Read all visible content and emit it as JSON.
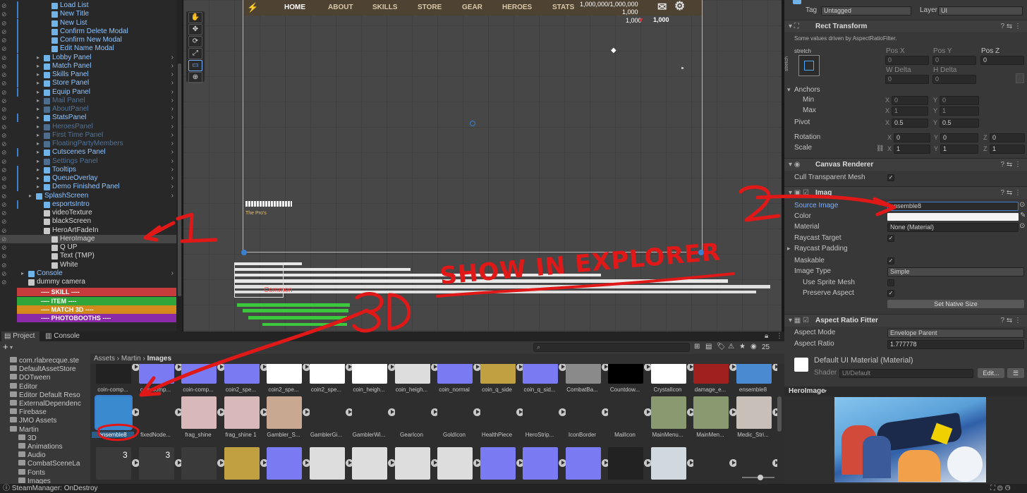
{
  "hierarchy": {
    "items": [
      {
        "label": "Load List",
        "indent": 5,
        "style": "blue"
      },
      {
        "label": "New Title",
        "indent": 5,
        "style": "blue"
      },
      {
        "label": "New List",
        "indent": 5,
        "style": "blue"
      },
      {
        "label": "Confirm Delete Modal",
        "indent": 5,
        "style": "blue"
      },
      {
        "label": "Confirm New Modal",
        "indent": 5,
        "style": "blue"
      },
      {
        "label": "Edit Name Modal",
        "indent": 5,
        "style": "blue"
      },
      {
        "label": "Lobby Panel",
        "indent": 4,
        "style": "blue",
        "arrow": true
      },
      {
        "label": "Match Panel",
        "indent": 4,
        "style": "blue",
        "arrow": true
      },
      {
        "label": "Skills Panel",
        "indent": 4,
        "style": "blue",
        "arrow": true
      },
      {
        "label": "Store Panel",
        "indent": 4,
        "style": "blue",
        "arrow": true
      },
      {
        "label": "Equip Panel",
        "indent": 4,
        "style": "blue",
        "arrow": true
      },
      {
        "label": "Mail Panel",
        "indent": 4,
        "style": "dim",
        "arrow": true
      },
      {
        "label": "AboutPanel",
        "indent": 4,
        "style": "dim",
        "arrow": true
      },
      {
        "label": "StatsPanel",
        "indent": 4,
        "style": "blue",
        "arrow": true
      },
      {
        "label": "HeroesPanel",
        "indent": 4,
        "style": "dim",
        "arrow": true
      },
      {
        "label": "First Time Panel",
        "indent": 4,
        "style": "dim",
        "arrow": true
      },
      {
        "label": "FloatingPartyMembers",
        "indent": 4,
        "style": "dim",
        "arrow": true
      },
      {
        "label": "Cutscenes Panel",
        "indent": 4,
        "style": "blue",
        "arrow": true
      },
      {
        "label": "Settings Panel",
        "indent": 4,
        "style": "dim",
        "arrow": true
      },
      {
        "label": "Tooltips",
        "indent": 4,
        "style": "blue",
        "arrow": true
      },
      {
        "label": "QueueOverlay",
        "indent": 4,
        "style": "blue",
        "arrow": true
      },
      {
        "label": "Demo Finished Panel",
        "indent": 4,
        "style": "blue",
        "arrow": true
      },
      {
        "label": "SplashScreen",
        "indent": 3,
        "style": "blue",
        "arrow": true
      },
      {
        "label": "esportsIntro",
        "indent": 4,
        "style": "blue"
      },
      {
        "label": "videoTexture",
        "indent": 4,
        "style": "wht"
      },
      {
        "label": "blackScreen",
        "indent": 4,
        "style": "wht"
      },
      {
        "label": "HeroArtFadeIn",
        "indent": 4,
        "style": "wht"
      },
      {
        "label": "HeroImage",
        "indent": 5,
        "style": "wht",
        "selected": true
      },
      {
        "label": "Q UP",
        "indent": 5,
        "style": "wht"
      },
      {
        "label": "Text (TMP)",
        "indent": 5,
        "style": "wht"
      },
      {
        "label": "White",
        "indent": 5,
        "style": "wht"
      },
      {
        "label": "Console",
        "indent": 2,
        "style": "blue",
        "arrow": true
      },
      {
        "label": "dummy camera",
        "indent": 2,
        "style": "wht"
      }
    ],
    "color_sections": [
      {
        "label": "---- SKILL ----",
        "color": "#c63b3b"
      },
      {
        "label": "---- ITEM ----",
        "color": "#2fa53a"
      },
      {
        "label": "---- MATCH 3D ----",
        "color": "#d4891c"
      },
      {
        "label": "---- PHOTOBOOTHS ----",
        "color": "#8a2aa8"
      }
    ]
  },
  "scene": {
    "nav": [
      "HOME",
      "ABOUT",
      "SKILLS",
      "STORE",
      "GEAR",
      "HEROES",
      "STATS"
    ],
    "currency_1": "1,000,000/1,000,000",
    "currency_2": "1,000",
    "currency_3": "1,000",
    "currency_4": "1,000",
    "pros_label": "The Pro's",
    "common_label": "Common",
    "tools": [
      "✋",
      "✥",
      "⟳",
      "⤢",
      "▭",
      "⊕"
    ]
  },
  "inspector": {
    "tag_label": "Tag",
    "tag_value": "Untagged",
    "layer_label": "Layer",
    "layer_value": "UI",
    "rect_transform": "Rect Transform",
    "driven_note": "Some values driven by AspectRatioFilter.",
    "stretch": "stretch",
    "pos_x": "Pos X",
    "pos_y": "Pos Y",
    "pos_z": "Pos Z",
    "pos_vals": [
      "0",
      "0",
      "0"
    ],
    "w_delta": "W Delta",
    "h_delta": "H Delta",
    "delta_vals": [
      "0",
      "0"
    ],
    "anchors": "Anchors",
    "min": "Min",
    "max": "Max",
    "min_vals": [
      "0",
      "0"
    ],
    "max_vals": [
      "1",
      "1"
    ],
    "pivot": "Pivot",
    "pivot_vals": [
      "0.5",
      "0.5"
    ],
    "rotation": "Rotation",
    "rotation_vals": [
      "0",
      "0",
      "0"
    ],
    "scale": "Scale",
    "scale_vals": [
      "1",
      "1",
      "1"
    ],
    "canvas_renderer": "Canvas Renderer",
    "cull": "Cull Transparent Mesh",
    "image": "Imag",
    "source_image": "Source Image",
    "source_value": "ensemble8",
    "color": "Color",
    "material": "Material",
    "material_value": "None (Material)",
    "raycast_target": "Raycast Target",
    "raycast_padding": "Raycast Padding",
    "maskable": "Maskable",
    "image_type": "Image Type",
    "image_type_value": "Simple",
    "use_sprite_mesh": "Use Sprite Mesh",
    "preserve_aspect": "Preserve Aspect",
    "set_native_size": "Set Native Size",
    "aspect_fitter": "Aspect Ratio Fitter",
    "aspect_mode": "Aspect Mode",
    "aspect_mode_value": "Envelope Parent",
    "aspect_ratio": "Aspect Ratio",
    "aspect_ratio_value": "1.777778",
    "default_material": "Default UI Material (Material)",
    "shader_label": "Shader",
    "shader_value": "UI/Default",
    "edit_button": "Edit...",
    "preview_title": "HeroImage"
  },
  "project": {
    "tab_project": "Project",
    "tab_console": "Console",
    "add_label": "+",
    "count": "25",
    "crumb_1": "Assets",
    "crumb_2": "Martin",
    "crumb_3": "Images",
    "tree": [
      {
        "label": "com.rlabrecque.ste",
        "indent": 1
      },
      {
        "label": "DefaultAssetStore",
        "indent": 1
      },
      {
        "label": "DOTween",
        "indent": 1
      },
      {
        "label": "Editor",
        "indent": 1
      },
      {
        "label": "Editor Default Reso",
        "indent": 1
      },
      {
        "label": "ExternalDependenc",
        "indent": 1
      },
      {
        "label": "Firebase",
        "indent": 1
      },
      {
        "label": "JMO Assets",
        "indent": 1
      },
      {
        "label": "Martin",
        "indent": 1
      },
      {
        "label": "3D",
        "indent": 2
      },
      {
        "label": "Animations",
        "indent": 2
      },
      {
        "label": "Audio",
        "indent": 2
      },
      {
        "label": "CombatSceneLa",
        "indent": 2
      },
      {
        "label": "Fonts",
        "indent": 2
      },
      {
        "label": "Images",
        "indent": 2
      }
    ],
    "row1": [
      "coin-comp...",
      "coin-comp...",
      "coin-comp...",
      "coin2_spe...",
      "coin2_spe...",
      "coin2_spe...",
      "coin_heigh...",
      "coin_heigh...",
      "coin_normal",
      "coin_q_side",
      "coin_q_sid...",
      "CombatBa...",
      "Countdow...",
      "CrystalIcon",
      "damage_e...",
      "ensemble8"
    ],
    "row2": [
      "ensemble8",
      "fixedNode...",
      "frag_shine",
      "frag_shine 1",
      "Gambler_S...",
      "GamblerGi...",
      "GamblerWi...",
      "GearIcon",
      "GoldIcon",
      "HealthPiece",
      "HeroStrip...",
      "IconBorder",
      "MailIcon",
      "MainMenu...",
      "MainMen...",
      "Medic_Stri..."
    ],
    "row3_badges": [
      "3",
      "3"
    ]
  },
  "status": {
    "message": "SteamManager: OnDestroy"
  },
  "annotations": {
    "step1": "1",
    "step2": "2",
    "step3": "3D",
    "note": "SHOW IN EXPLORER"
  }
}
